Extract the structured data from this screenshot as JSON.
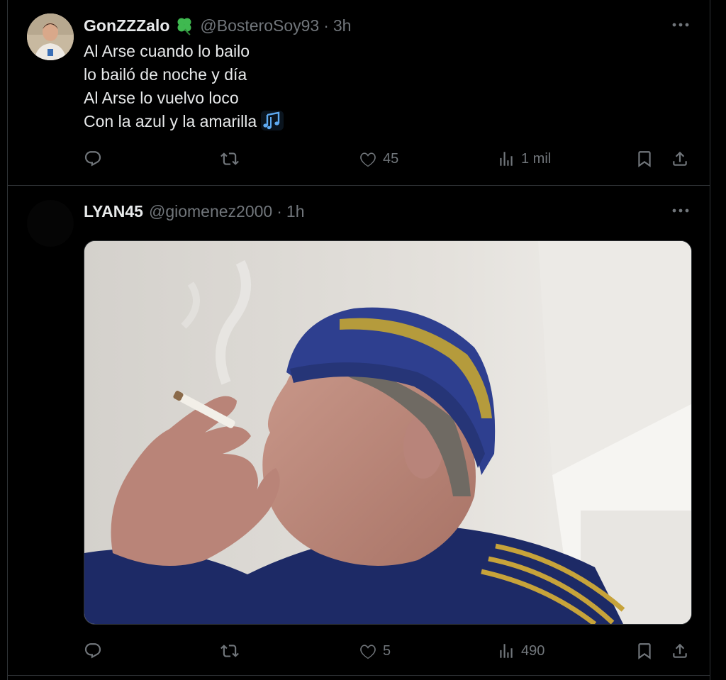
{
  "tweets": [
    {
      "display_name": "GonZZZalo",
      "handle": "@BosteroSoy93",
      "separator": "·",
      "time": "3h",
      "badge_icon": "four-leaf-clover-icon",
      "lines": [
        "Al Arse cuando lo bailo",
        "lo bailó de noche y día",
        "Al Arse lo vuelvo loco",
        "Con la azul y la amarilla"
      ],
      "trailing_icon": "musical-notes-icon",
      "stats": {
        "replies": "",
        "reposts": "",
        "likes": "45",
        "views": "1 mil"
      }
    },
    {
      "display_name": "LYAN45",
      "handle": "@giomenez2000",
      "separator": "·",
      "time": "1h",
      "media_description": "photo-man-smoking-blue-yellow-beanie",
      "stats": {
        "replies": "",
        "reposts": "",
        "likes": "5",
        "views": "490"
      }
    }
  ],
  "colors": {
    "background": "#000000",
    "text_primary": "#e7e9ea",
    "text_secondary": "#71767b",
    "divider": "#2f3336",
    "clover": "#3fb950",
    "music_note": "#5eaaf2"
  }
}
